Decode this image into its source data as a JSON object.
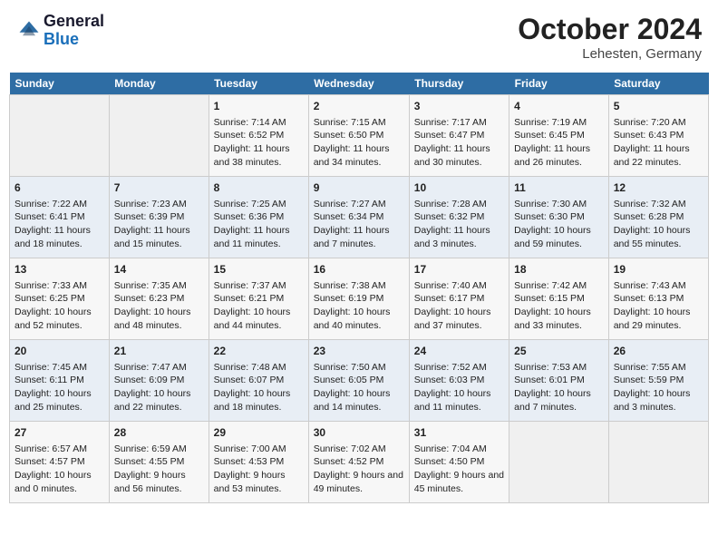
{
  "header": {
    "logo_general": "General",
    "logo_blue": "Blue",
    "month_title": "October 2024",
    "location": "Lehesten, Germany"
  },
  "columns": [
    "Sunday",
    "Monday",
    "Tuesday",
    "Wednesday",
    "Thursday",
    "Friday",
    "Saturday"
  ],
  "weeks": [
    [
      {
        "day": "",
        "info": ""
      },
      {
        "day": "",
        "info": ""
      },
      {
        "day": "1",
        "info": "Sunrise: 7:14 AM\nSunset: 6:52 PM\nDaylight: 11 hours and 38 minutes."
      },
      {
        "day": "2",
        "info": "Sunrise: 7:15 AM\nSunset: 6:50 PM\nDaylight: 11 hours and 34 minutes."
      },
      {
        "day": "3",
        "info": "Sunrise: 7:17 AM\nSunset: 6:47 PM\nDaylight: 11 hours and 30 minutes."
      },
      {
        "day": "4",
        "info": "Sunrise: 7:19 AM\nSunset: 6:45 PM\nDaylight: 11 hours and 26 minutes."
      },
      {
        "day": "5",
        "info": "Sunrise: 7:20 AM\nSunset: 6:43 PM\nDaylight: 11 hours and 22 minutes."
      }
    ],
    [
      {
        "day": "6",
        "info": "Sunrise: 7:22 AM\nSunset: 6:41 PM\nDaylight: 11 hours and 18 minutes."
      },
      {
        "day": "7",
        "info": "Sunrise: 7:23 AM\nSunset: 6:39 PM\nDaylight: 11 hours and 15 minutes."
      },
      {
        "day": "8",
        "info": "Sunrise: 7:25 AM\nSunset: 6:36 PM\nDaylight: 11 hours and 11 minutes."
      },
      {
        "day": "9",
        "info": "Sunrise: 7:27 AM\nSunset: 6:34 PM\nDaylight: 11 hours and 7 minutes."
      },
      {
        "day": "10",
        "info": "Sunrise: 7:28 AM\nSunset: 6:32 PM\nDaylight: 11 hours and 3 minutes."
      },
      {
        "day": "11",
        "info": "Sunrise: 7:30 AM\nSunset: 6:30 PM\nDaylight: 10 hours and 59 minutes."
      },
      {
        "day": "12",
        "info": "Sunrise: 7:32 AM\nSunset: 6:28 PM\nDaylight: 10 hours and 55 minutes."
      }
    ],
    [
      {
        "day": "13",
        "info": "Sunrise: 7:33 AM\nSunset: 6:25 PM\nDaylight: 10 hours and 52 minutes."
      },
      {
        "day": "14",
        "info": "Sunrise: 7:35 AM\nSunset: 6:23 PM\nDaylight: 10 hours and 48 minutes."
      },
      {
        "day": "15",
        "info": "Sunrise: 7:37 AM\nSunset: 6:21 PM\nDaylight: 10 hours and 44 minutes."
      },
      {
        "day": "16",
        "info": "Sunrise: 7:38 AM\nSunset: 6:19 PM\nDaylight: 10 hours and 40 minutes."
      },
      {
        "day": "17",
        "info": "Sunrise: 7:40 AM\nSunset: 6:17 PM\nDaylight: 10 hours and 37 minutes."
      },
      {
        "day": "18",
        "info": "Sunrise: 7:42 AM\nSunset: 6:15 PM\nDaylight: 10 hours and 33 minutes."
      },
      {
        "day": "19",
        "info": "Sunrise: 7:43 AM\nSunset: 6:13 PM\nDaylight: 10 hours and 29 minutes."
      }
    ],
    [
      {
        "day": "20",
        "info": "Sunrise: 7:45 AM\nSunset: 6:11 PM\nDaylight: 10 hours and 25 minutes."
      },
      {
        "day": "21",
        "info": "Sunrise: 7:47 AM\nSunset: 6:09 PM\nDaylight: 10 hours and 22 minutes."
      },
      {
        "day": "22",
        "info": "Sunrise: 7:48 AM\nSunset: 6:07 PM\nDaylight: 10 hours and 18 minutes."
      },
      {
        "day": "23",
        "info": "Sunrise: 7:50 AM\nSunset: 6:05 PM\nDaylight: 10 hours and 14 minutes."
      },
      {
        "day": "24",
        "info": "Sunrise: 7:52 AM\nSunset: 6:03 PM\nDaylight: 10 hours and 11 minutes."
      },
      {
        "day": "25",
        "info": "Sunrise: 7:53 AM\nSunset: 6:01 PM\nDaylight: 10 hours and 7 minutes."
      },
      {
        "day": "26",
        "info": "Sunrise: 7:55 AM\nSunset: 5:59 PM\nDaylight: 10 hours and 3 minutes."
      }
    ],
    [
      {
        "day": "27",
        "info": "Sunrise: 6:57 AM\nSunset: 4:57 PM\nDaylight: 10 hours and 0 minutes."
      },
      {
        "day": "28",
        "info": "Sunrise: 6:59 AM\nSunset: 4:55 PM\nDaylight: 9 hours and 56 minutes."
      },
      {
        "day": "29",
        "info": "Sunrise: 7:00 AM\nSunset: 4:53 PM\nDaylight: 9 hours and 53 minutes."
      },
      {
        "day": "30",
        "info": "Sunrise: 7:02 AM\nSunset: 4:52 PM\nDaylight: 9 hours and 49 minutes."
      },
      {
        "day": "31",
        "info": "Sunrise: 7:04 AM\nSunset: 4:50 PM\nDaylight: 9 hours and 45 minutes."
      },
      {
        "day": "",
        "info": ""
      },
      {
        "day": "",
        "info": ""
      }
    ]
  ]
}
